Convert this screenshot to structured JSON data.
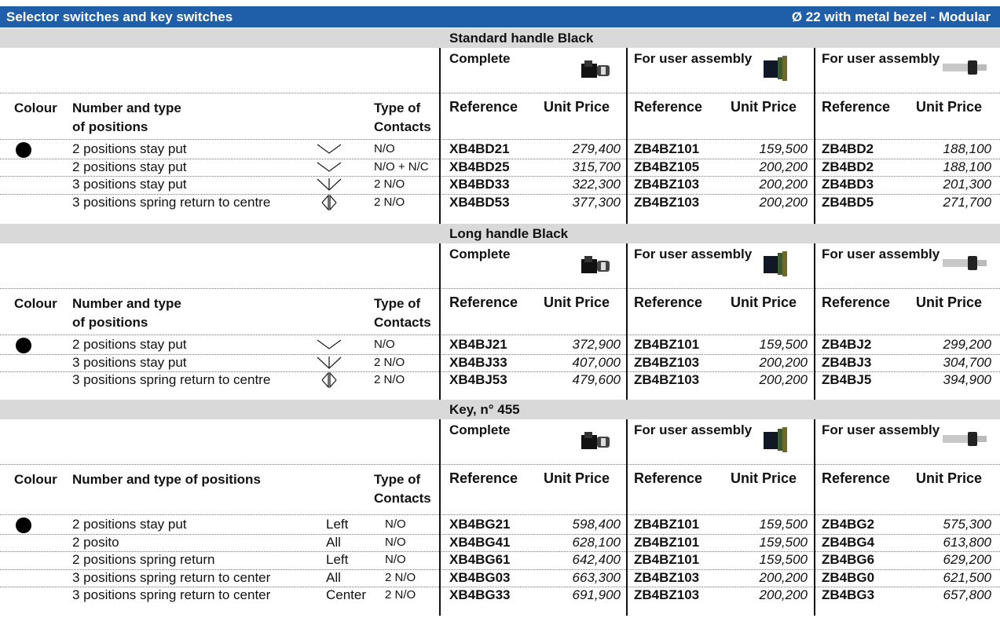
{
  "header": {
    "title": "Selector switches and key switches",
    "subtitle": "Ø 22 with metal bezel - Modular"
  },
  "columns": {
    "complete": "Complete",
    "user_assembly": "For user assembly",
    "colour": "Colour",
    "number_type": "Number and type",
    "of_positions": "of positions",
    "number_type_full": "Number and type of positions",
    "type_of": "Type of",
    "contacts": "Contacts",
    "reference": "Reference",
    "unit_price": "Unit Price"
  },
  "sections": [
    {
      "title": "Standard handle Black",
      "rows": [
        {
          "desc": "2 positions stay put",
          "symbol": "v-icon",
          "contacts": "N/O",
          "ref1": "XB4BD21",
          "price1": "279,400",
          "ref2": "ZB4BZ101",
          "price2": "159,500",
          "ref3": "ZB4BD2",
          "price3": "188,100"
        },
        {
          "desc": "2 positions stay put",
          "symbol": "v-icon",
          "contacts": "N/O + N/C",
          "ref1": "XB4BD25",
          "price1": "315,700",
          "ref2": "ZB4BZ105",
          "price2": "200,200",
          "ref3": "ZB4BD2",
          "price3": "188,100"
        },
        {
          "desc": "3 positions stay put",
          "symbol": "v-arrow-icon",
          "contacts": "2 N/O",
          "ref1": "XB4BD33",
          "price1": "322,300",
          "ref2": "ZB4BZ103",
          "price2": "200,200",
          "ref3": "ZB4BD3",
          "price3": "201,300"
        },
        {
          "desc": "3 positions spring return to centre",
          "symbol": "double-arrow-icon",
          "contacts": "2 N/O",
          "ref1": "XB4BD53",
          "price1": "377,300",
          "ref2": "ZB4BZ103",
          "price2": "200,200",
          "ref3": "ZB4BD5",
          "price3": "271,700"
        }
      ]
    },
    {
      "title": "Long handle Black",
      "rows": [
        {
          "desc": "2 positions stay put",
          "symbol": "v-icon",
          "contacts": "N/O",
          "ref1": "XB4BJ21",
          "price1": "372,900",
          "ref2": "ZB4BZ101",
          "price2": "159,500",
          "ref3": "ZB4BJ2",
          "price3": "299,200"
        },
        {
          "desc": "3 positions stay put",
          "symbol": "v-arrow-icon",
          "contacts": "2 N/O",
          "ref1": "XB4BJ33",
          "price1": "407,000",
          "ref2": "ZB4BZ103",
          "price2": "200,200",
          "ref3": "ZB4BJ3",
          "price3": "304,700"
        },
        {
          "desc": "3 positions spring return to centre",
          "symbol": "double-arrow-icon",
          "contacts": "2 N/O",
          "ref1": "XB4BJ53",
          "price1": "479,600",
          "ref2": "ZB4BZ103",
          "price2": "200,200",
          "ref3": "ZB4BJ5",
          "price3": "394,900"
        }
      ]
    },
    {
      "title": "Key, n° 455",
      "rows": [
        {
          "desc": "2 positions stay put",
          "key": "Left",
          "contacts": "N/O",
          "ref1": "XB4BG21",
          "price1": "598,400",
          "ref2": "ZB4BZ101",
          "price2": "159,500",
          "ref3": "ZB4BG2",
          "price3": "575,300"
        },
        {
          "desc": "2 posito",
          "key": "All",
          "contacts": "N/O",
          "ref1": "XB4BG41",
          "price1": "628,100",
          "ref2": "ZB4BZ101",
          "price2": "159,500",
          "ref3": "ZB4BG4",
          "price3": "613,800"
        },
        {
          "desc": "2 positions spring return",
          "key": "Left",
          "contacts": "N/O",
          "ref1": "XB4BG61",
          "price1": "642,400",
          "ref2": "ZB4BZ101",
          "price2": "159,500",
          "ref3": "ZB4BG6",
          "price3": "629,200"
        },
        {
          "desc": "3 positions spring return to center",
          "key": "All",
          "contacts": "2 N/O",
          "ref1": "XB4BG03",
          "price1": "663,300",
          "ref2": "ZB4BZ103",
          "price2": "200,200",
          "ref3": "ZB4BG0",
          "price3": "621,500"
        },
        {
          "desc": "3 positions spring return to center",
          "key": "Center",
          "contacts": "2 N/O",
          "ref1": "XB4BG33",
          "price1": "691,900",
          "ref2": "ZB4BZ103",
          "price2": "200,200",
          "ref3": "ZB4BG3",
          "price3": "657,800"
        }
      ]
    }
  ]
}
